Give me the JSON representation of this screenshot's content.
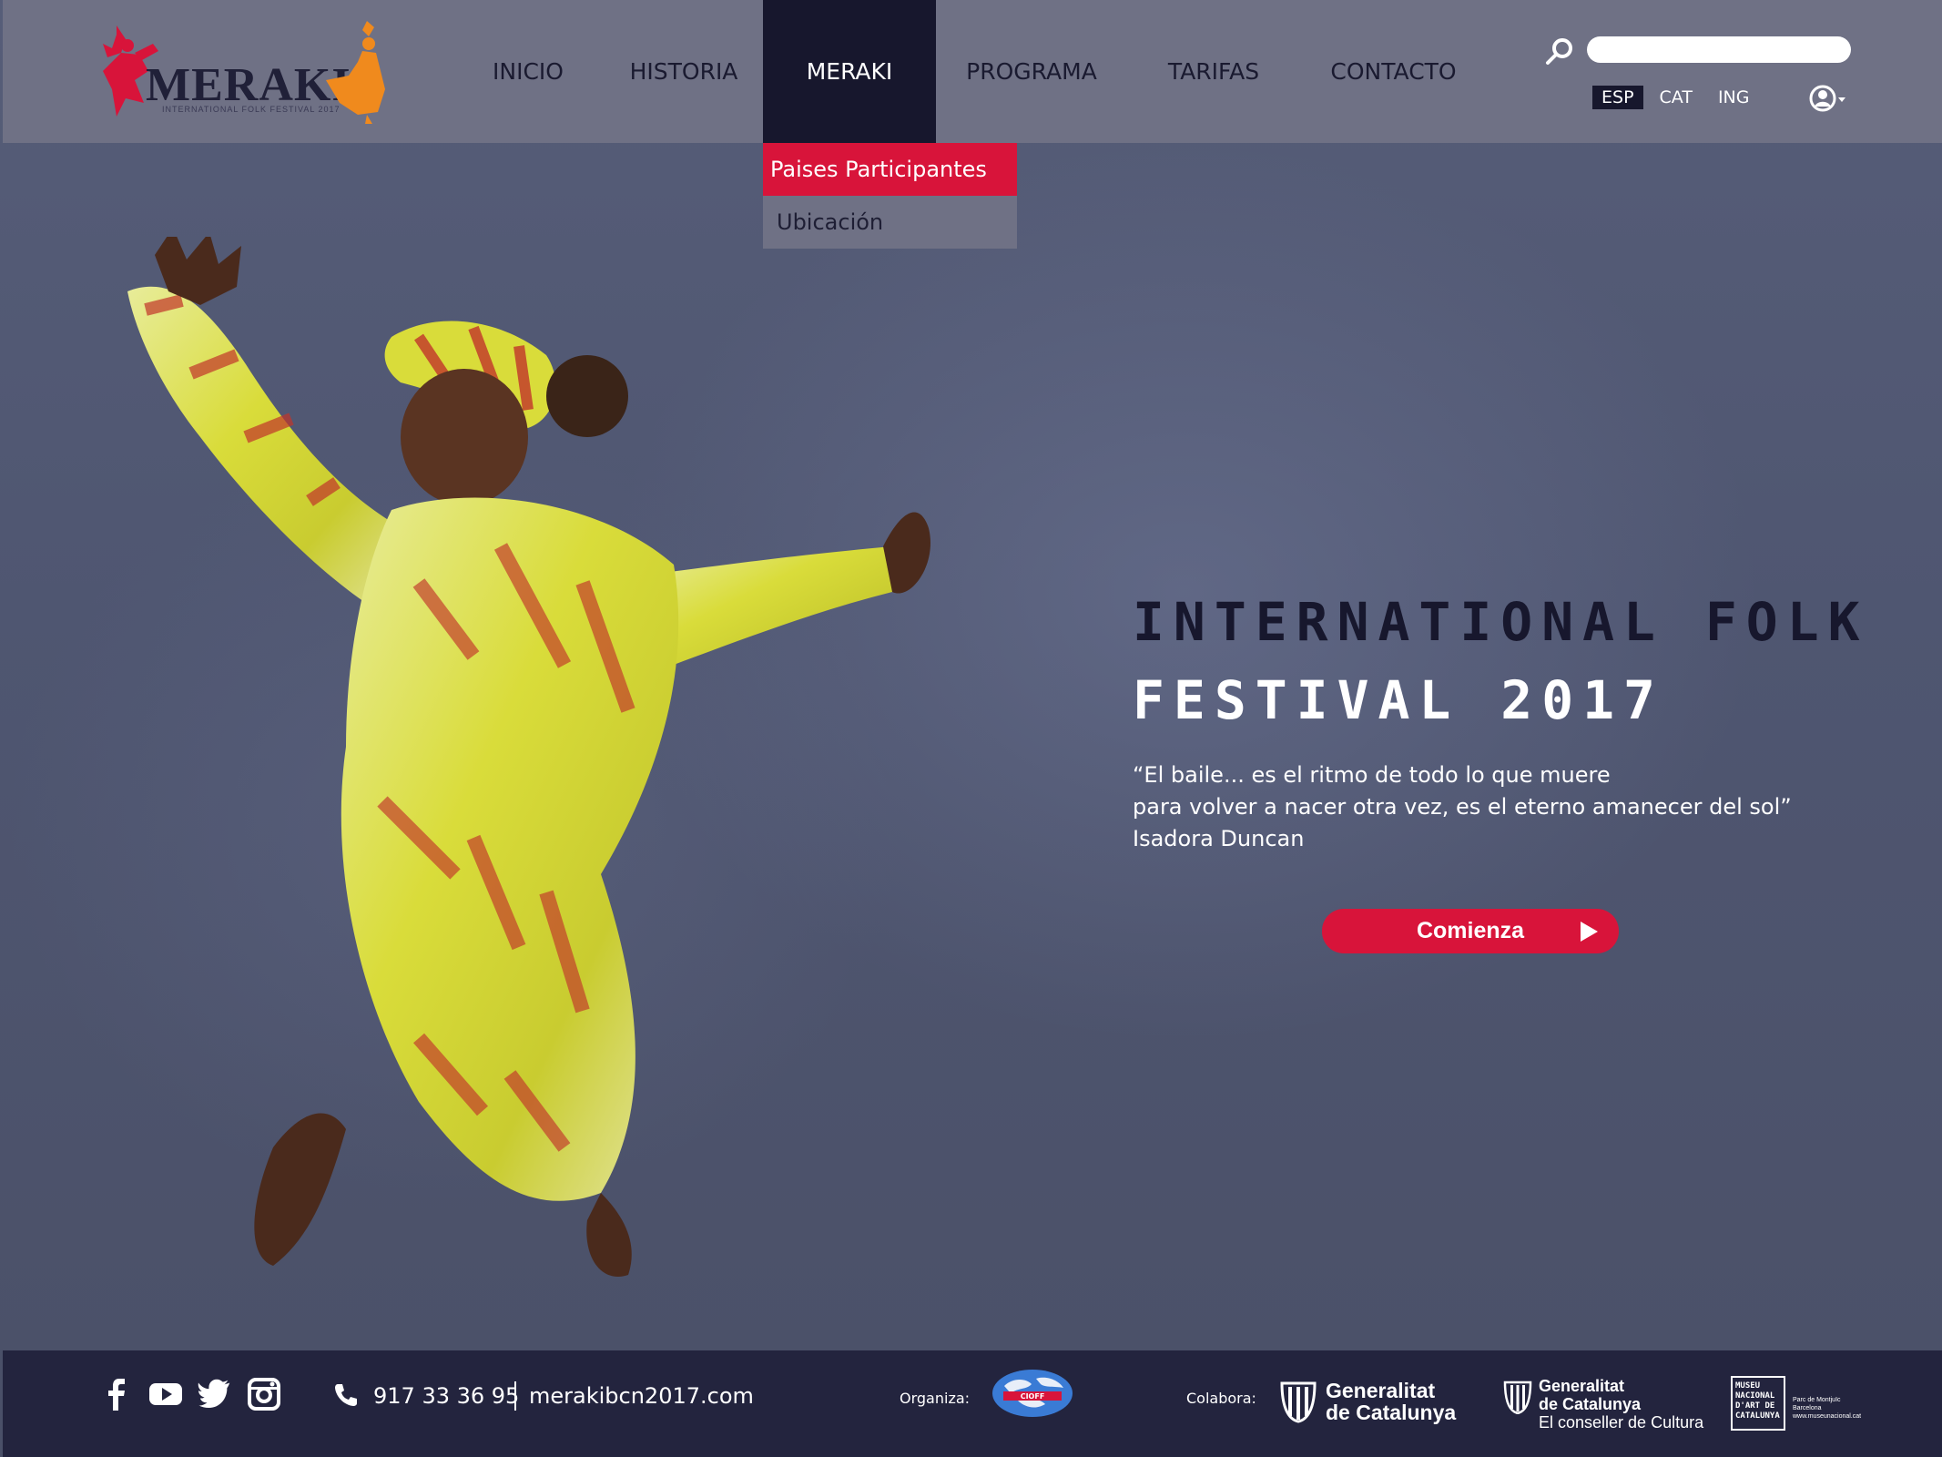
{
  "brand": {
    "logo_text": "MERAKI",
    "logo_subtitle": "INTERNATIONAL FOLK FESTIVAL 2017",
    "accent_red": "#d8143a",
    "accent_orange": "#f08a1d",
    "navy": "#17172d"
  },
  "nav": {
    "items": [
      {
        "label": "INICIO"
      },
      {
        "label": "HISTORIA"
      },
      {
        "label": "MERAKI"
      },
      {
        "label": "PROGRAMA"
      },
      {
        "label": "TARIFAS"
      },
      {
        "label": "CONTACTO"
      }
    ],
    "active": "MERAKI",
    "dropdown": [
      {
        "label": "Paises Participantes"
      },
      {
        "label": "Ubicación"
      }
    ]
  },
  "search": {
    "placeholder": "",
    "icon": "search-icon"
  },
  "languages": [
    {
      "label": "ESP"
    },
    {
      "label": "CAT"
    },
    {
      "label": "ING"
    }
  ],
  "active_language": "ESP",
  "user": {
    "icon": "user-icon"
  },
  "hero": {
    "title_line1": "INTERNATIONAL FOLK",
    "title_line2": "FESTIVAL 2017",
    "quote_line1": "“El baile... es el ritmo de todo lo que muere",
    "quote_line2": "para volver a nacer otra vez, es el eterno amanecer del sol”",
    "quote_author": "Isadora Duncan",
    "cta_label": "Comienza"
  },
  "footer": {
    "social": [
      "facebook-icon",
      "youtube-icon",
      "twitter-icon",
      "instagram-icon"
    ],
    "phone": "917 33 36 95",
    "website": "merakibcn2017.com",
    "organiza_label": "Organiza:",
    "organizer_logo_text": "CIOFF",
    "colabora_label": "Colabora:",
    "gen1_line1": "Generalitat",
    "gen1_line2": "de Catalunya",
    "gen2_line1": "Generalitat",
    "gen2_line2": "de Catalunya",
    "gen2_line3": "El conseller de Cultura",
    "mnac_lines": "MUSEU NACIONAL D'ART DE CATALUNYA",
    "mnac_side": "Parc de Montjuïc Barcelona www.museunacional.cat"
  }
}
